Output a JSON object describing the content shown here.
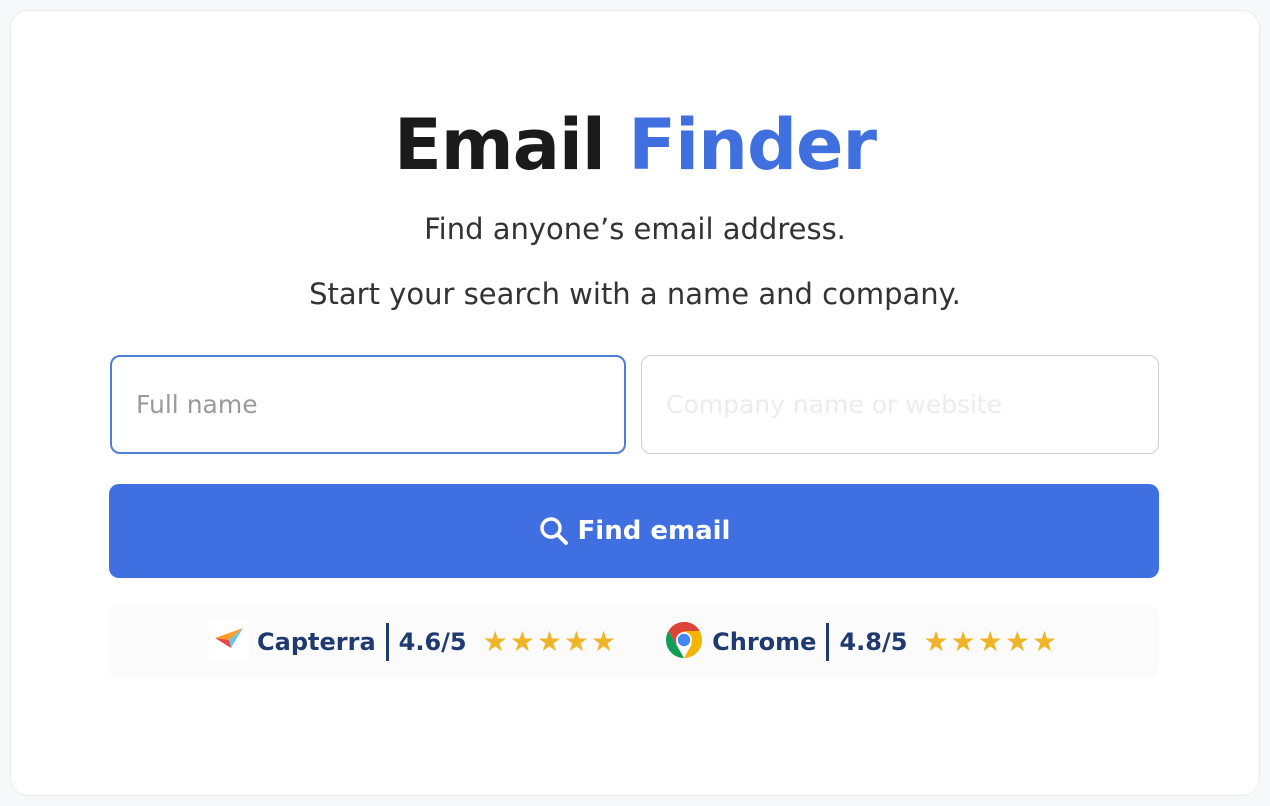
{
  "header": {
    "title_main": "Email",
    "title_accent": "Finder",
    "subtitle_1": "Find anyone’s email address.",
    "subtitle_2": "Start your search with a name and company."
  },
  "form": {
    "full_name": {
      "value": "",
      "placeholder": "Full name"
    },
    "company": {
      "value": "",
      "placeholder": "Company name or website"
    },
    "submit_label": "Find email",
    "submit_icon": "search-icon"
  },
  "ratings": [
    {
      "name": "Capterra",
      "icon": "capterra-logo",
      "score": "4.6/5",
      "stars": "★★★★★",
      "rating_value": 4.6
    },
    {
      "name": "Chrome",
      "icon": "chrome-logo",
      "score": "4.8/5",
      "stars": "★★★★★",
      "rating_value": 4.8
    }
  ],
  "colors": {
    "accent": "#4070e0",
    "button": "#3f6fe0",
    "rating_text": "#1e3a6e",
    "star": "#f0b429"
  }
}
